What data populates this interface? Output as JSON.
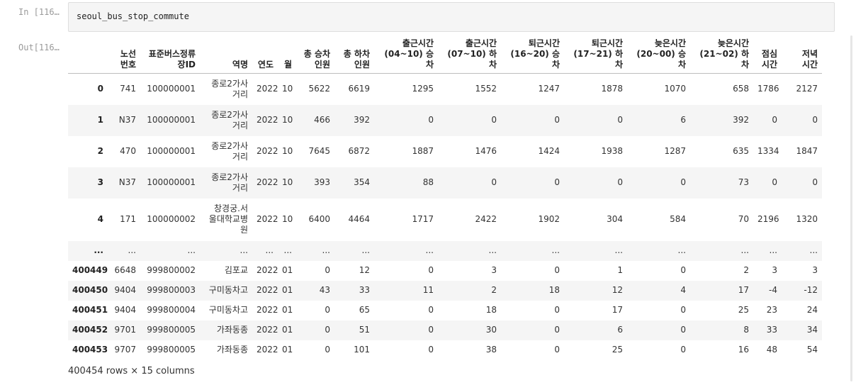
{
  "input_prompt": "In [116…",
  "output_prompt": "Out[116…",
  "code": "seoul_bus_stop_commute",
  "table": {
    "columns": [
      "",
      "노선\n번호",
      "표준버스정류\n장ID",
      "역명",
      "연도",
      "월",
      "총 승차\n인원",
      "총 하차\n인원",
      "출근시간\n(04~10) 승차",
      "출근시간\n(07~10) 하차",
      "퇴근시간\n(16~20) 승차",
      "퇴근시간\n(17~21) 하차",
      "늦은시간\n(20~00) 승차",
      "늦은시간\n(21~02) 하차",
      "점심\n시간",
      "저녁\n시간"
    ],
    "rows": [
      [
        "0",
        "741",
        "100000001",
        "종로2가사\n거리",
        "2022",
        "10",
        "5622",
        "6619",
        "1295",
        "1552",
        "1247",
        "1878",
        "1070",
        "658",
        "1786",
        "2127"
      ],
      [
        "1",
        "N37",
        "100000001",
        "종로2가사\n거리",
        "2022",
        "10",
        "466",
        "392",
        "0",
        "0",
        "0",
        "0",
        "6",
        "392",
        "0",
        "0"
      ],
      [
        "2",
        "470",
        "100000001",
        "종로2가사\n거리",
        "2022",
        "10",
        "7645",
        "6872",
        "1887",
        "1476",
        "1424",
        "1938",
        "1287",
        "635",
        "1334",
        "1847"
      ],
      [
        "3",
        "N37",
        "100000001",
        "종로2가사\n거리",
        "2022",
        "10",
        "393",
        "354",
        "88",
        "0",
        "0",
        "0",
        "0",
        "73",
        "0",
        "0"
      ],
      [
        "4",
        "171",
        "100000002",
        "창경궁.서\n울대학교병\n원",
        "2022",
        "10",
        "6400",
        "4464",
        "1717",
        "2422",
        "1902",
        "304",
        "584",
        "70",
        "2196",
        "1320"
      ],
      [
        "...",
        "...",
        "...",
        "...",
        "...",
        "...",
        "...",
        "...",
        "...",
        "...",
        "...",
        "...",
        "...",
        "...",
        "...",
        "..."
      ],
      [
        "400449",
        "6648",
        "999800002",
        "김포교",
        "2022",
        "01",
        "0",
        "12",
        "0",
        "3",
        "0",
        "1",
        "0",
        "2",
        "3",
        "3"
      ],
      [
        "400450",
        "9404",
        "999800003",
        "구미동차고",
        "2022",
        "01",
        "43",
        "33",
        "11",
        "2",
        "18",
        "12",
        "4",
        "17",
        "-4",
        "-12"
      ],
      [
        "400451",
        "9404",
        "999800004",
        "구미동차고",
        "2022",
        "01",
        "0",
        "65",
        "0",
        "18",
        "0",
        "17",
        "0",
        "25",
        "23",
        "24"
      ],
      [
        "400452",
        "9701",
        "999800005",
        "가좌동종",
        "2022",
        "01",
        "0",
        "51",
        "0",
        "30",
        "0",
        "6",
        "0",
        "8",
        "33",
        "34"
      ],
      [
        "400453",
        "9707",
        "999800005",
        "가좌동종",
        "2022",
        "01",
        "0",
        "101",
        "0",
        "38",
        "0",
        "25",
        "0",
        "16",
        "48",
        "54"
      ]
    ]
  },
  "footer": "400454 rows × 15 columns"
}
